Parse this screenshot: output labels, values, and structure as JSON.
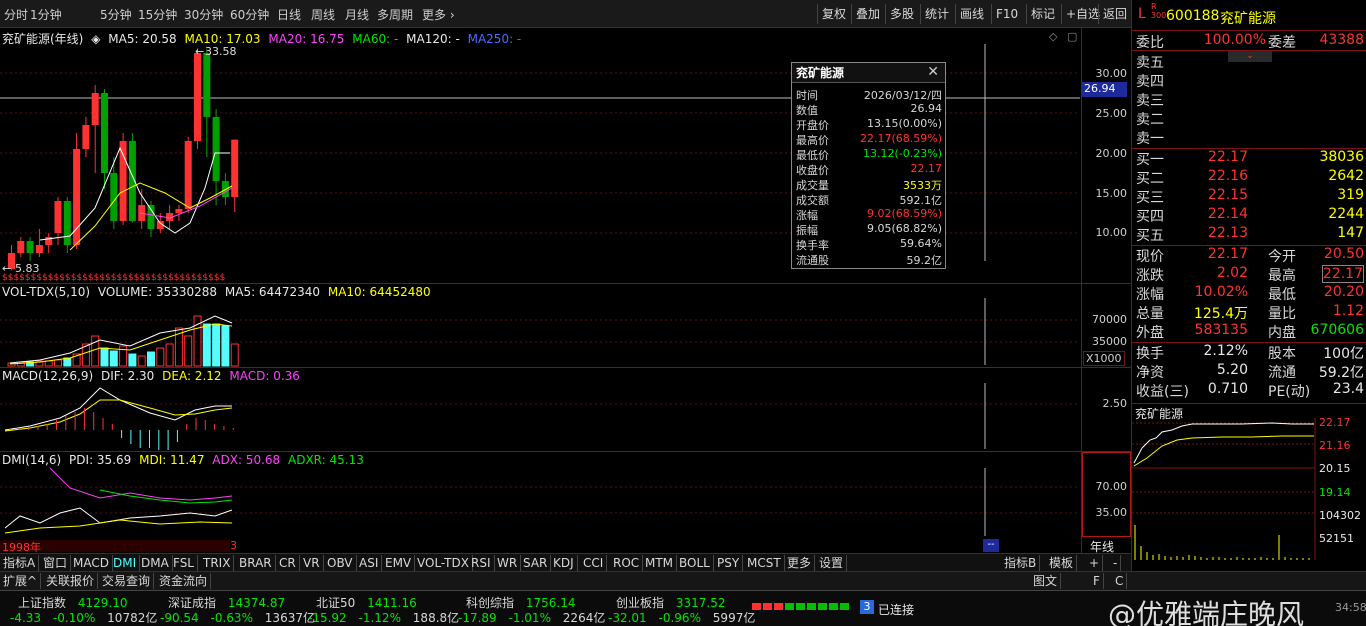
{
  "periods": [
    "分时",
    "1分钟",
    "5分钟",
    "15分钟",
    "30分钟",
    "60分钟",
    "日线",
    "周线",
    "月线",
    "多周期",
    "更多"
  ],
  "tools": [
    "复权",
    "叠加",
    "多股",
    "统计",
    "画线",
    "F10",
    "标记",
    "+自选",
    "返回"
  ],
  "chart": {
    "title": "兖矿能源(年线)",
    "ma5": "MA5: 20.58",
    "ma10": "MA10: 17.03",
    "ma20": "MA20: 16.75",
    "ma60": "MA60: -",
    "ma120": "MA120: -",
    "ma250": "MA250: -",
    "high_mark": "33.58",
    "low_mark": "5.83",
    "cursor_price": "26.94",
    "year_label": "1998年",
    "cursor_count": "3",
    "price_axis": [
      "30.00",
      "25.00",
      "20.00",
      "15.00",
      "10.00"
    ],
    "vol_axis": [
      "70000",
      "35000"
    ],
    "vol_unit": "X1000",
    "macd_axis": [
      "2.50"
    ],
    "dmi_axis": [
      "70.00",
      "35.00"
    ],
    "vol_head": "VOL-TDX(5,10)",
    "vol_volume": "VOLUME: 35330288",
    "vol_ma5": "MA5: 64472340",
    "vol_ma10": "MA10: 64452480",
    "macd_head": "MACD(12,26,9)",
    "macd_dif": "DIF: 2.30",
    "macd_dea": "DEA: 2.12",
    "macd_val": "MACD: 0.36",
    "dmi_head": "DMI(14,6)",
    "dmi_pdi": "PDI: 35.69",
    "dmi_mdi": "MDI: 11.47",
    "dmi_adx": "ADX: 50.68",
    "dmi_adxr": "ADXR: 45.13",
    "cursor_tag": "--"
  },
  "tooltip": {
    "title": "兖矿能源",
    "rows": [
      {
        "k": "时间",
        "v": "2026/03/12/四",
        "c": "#d8d8d8"
      },
      {
        "k": "数值",
        "v": "26.94",
        "c": "#d8d8d8"
      },
      {
        "k": "开盘价",
        "v": "13.15(0.00%)",
        "c": "#d8d8d8"
      },
      {
        "k": "最高价",
        "v": "22.17(68.59%)",
        "c": "#ff3232"
      },
      {
        "k": "最低价",
        "v": "13.12(-0.23%)",
        "c": "#00e600"
      },
      {
        "k": "收盘价",
        "v": "22.17",
        "c": "#ff3232"
      },
      {
        "k": "成交量",
        "v": "3533万",
        "c": "#ffff00"
      },
      {
        "k": "成交额",
        "v": "592.1亿",
        "c": "#d8d8d8"
      },
      {
        "k": "涨幅",
        "v": "9.02(68.59%)",
        "c": "#ff3232"
      },
      {
        "k": "振幅",
        "v": "9.05(68.82%)",
        "c": "#d8d8d8"
      },
      {
        "k": "换手率",
        "v": "59.64%",
        "c": "#d8d8d8"
      },
      {
        "k": "流通股",
        "v": "59.2亿",
        "c": "#d8d8d8"
      }
    ]
  },
  "quote": {
    "code": "600188",
    "name": "兖矿能源",
    "weibi_label": "委比",
    "weibi": "100.00%",
    "weicha_label": "委差",
    "weicha": "43388",
    "sells": [
      {
        "label": "卖五",
        "price": "",
        "vol": ""
      },
      {
        "label": "卖四",
        "price": "",
        "vol": ""
      },
      {
        "label": "卖三",
        "price": "",
        "vol": ""
      },
      {
        "label": "卖二",
        "price": "",
        "vol": ""
      },
      {
        "label": "卖一",
        "price": "",
        "vol": ""
      }
    ],
    "buys": [
      {
        "label": "买一",
        "price": "22.17",
        "vol": "38036"
      },
      {
        "label": "买二",
        "price": "22.16",
        "vol": "2642"
      },
      {
        "label": "买三",
        "price": "22.15",
        "vol": "319"
      },
      {
        "label": "买四",
        "price": "22.14",
        "vol": "2244"
      },
      {
        "label": "买五",
        "price": "22.13",
        "vol": "147"
      }
    ],
    "stats": [
      {
        "k": "现价",
        "v": "22.17",
        "vc": "#ff3232",
        "k2": "今开",
        "v2": "20.50",
        "v2c": "#ff3232"
      },
      {
        "k": "涨跌",
        "v": "2.02",
        "vc": "#ff3232",
        "k2": "最高",
        "v2": "22.17",
        "v2c": "#ff3232"
      },
      {
        "k": "涨幅",
        "v": "10.02%",
        "vc": "#ff3232",
        "k2": "最低",
        "v2": "20.20",
        "v2c": "#ff3232"
      },
      {
        "k": "总量",
        "v": "125.4万",
        "vc": "#ffff00",
        "k2": "量比",
        "v2": "1.12",
        "v2c": "#ff3232"
      },
      {
        "k": "外盘",
        "v": "583135",
        "vc": "#ff3232",
        "k2": "内盘",
        "v2": "670606",
        "v2c": "#00e600"
      }
    ],
    "stats2": [
      {
        "k": "换手",
        "v": "2.12%",
        "k2": "股本",
        "v2": "100亿"
      },
      {
        "k": "净资",
        "v": "5.20",
        "k2": "流通",
        "v2": "59.2亿"
      },
      {
        "k": "收益(三)",
        "v": "0.710",
        "k2": "PE(动)",
        "v2": "23.4"
      }
    ],
    "mini_title": "兖矿能源",
    "mini_axis": [
      "22.17",
      "21.16",
      "20.15",
      "19.14"
    ],
    "mini_vol_axis": [
      "104302",
      "52151"
    ]
  },
  "tabs": [
    "指标A",
    "窗口",
    "MACD",
    "DMI",
    "DMA",
    "FSL",
    "TRIX",
    "BRAR",
    "CR",
    "VR",
    "OBV",
    "ASI",
    "EMV",
    "VOL-TDX",
    "RSI",
    "WR",
    "SAR",
    "KDJ",
    "CCI",
    "ROC",
    "MTM",
    "BOLL",
    "PSY",
    "MCST",
    "更多",
    "设置"
  ],
  "tabs_right": [
    "指标B",
    "模板",
    "+",
    "-"
  ],
  "year_tab": "年线",
  "tabs2": [
    "扩展^",
    "关联报价",
    "交易查询",
    "资金流向"
  ],
  "tabs2_right": [
    "图文",
    "F",
    "C"
  ],
  "indices": [
    {
      "name": "上证指数",
      "val": "4129.10",
      "chg": "-4.33",
      "pct": "-0.10%",
      "amt": "10782亿"
    },
    {
      "name": "深证成指",
      "val": "14374.87",
      "chg": "-90.54",
      "pct": "-0.63%",
      "amt": "13637亿"
    },
    {
      "name": "北证50",
      "val": "1411.16",
      "chg": "-15.92",
      "pct": "-1.12%",
      "amt": "188.8亿"
    },
    {
      "name": "科创综指",
      "val": "1756.14",
      "chg": "-17.89",
      "pct": "-1.01%",
      "amt": "2264亿"
    },
    {
      "name": "创业板指",
      "val": "3317.52",
      "chg": "-32.01",
      "pct": "-0.96%",
      "amt": "5997亿"
    }
  ],
  "conn": {
    "badge": "3",
    "text": "已连接"
  },
  "watermark": "@优雅端庄晚风",
  "clock": "34:58"
}
